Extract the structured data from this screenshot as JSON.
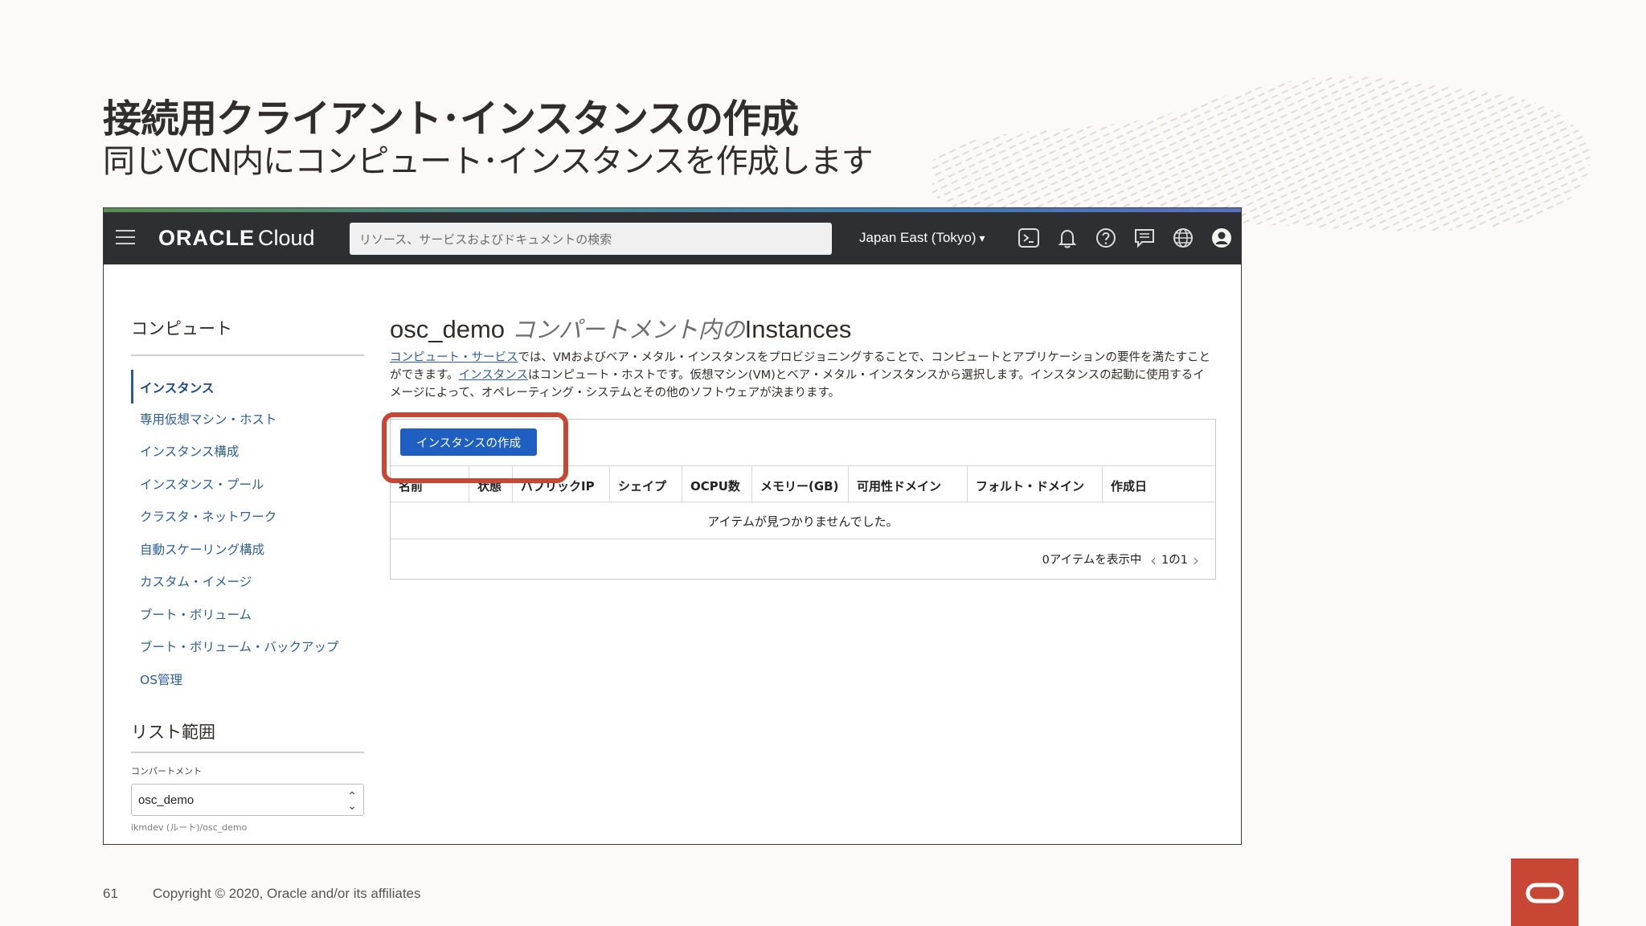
{
  "slide": {
    "title": "接続用クライアント･インスタンスの作成",
    "subtitle": "同じVCN内にコンピュート･インスタンスを作成します",
    "page_number": "61",
    "copyright": "Copyright © 2020, Oracle and/or its affiliates"
  },
  "console": {
    "topbar": {
      "logo_main": "ORACLE",
      "logo_sub": "Cloud",
      "search_placeholder": "リソース、サービスおよびドキュメントの検索",
      "region": "Japan East (Tokyo)",
      "icons": [
        "cloud-shell-icon",
        "bell-icon",
        "help-icon",
        "chat-icon",
        "globe-icon",
        "user-icon"
      ]
    },
    "sidebar": {
      "heading": "コンピュート",
      "items": [
        {
          "label": "インスタンス",
          "active": true
        },
        {
          "label": "専用仮想マシン・ホスト"
        },
        {
          "label": "インスタンス構成"
        },
        {
          "label": "インスタンス・プール"
        },
        {
          "label": "クラスタ・ネットワーク"
        },
        {
          "label": "自動スケーリング構成"
        },
        {
          "label": "カスタム・イメージ"
        },
        {
          "label": "ブート・ボリューム"
        },
        {
          "label": "ブート・ボリューム・バックアップ"
        },
        {
          "label": "OS管理"
        }
      ],
      "scope_heading": "リスト範囲",
      "compartment_label": "コンパートメント",
      "compartment_value": "osc_demo",
      "compartment_path": "ikmdev (ルート)/osc_demo"
    },
    "main": {
      "heading_name": "osc_demo",
      "heading_italic": "コンパートメント内の",
      "heading_suffix": "Instances",
      "desc_link1": "コンピュート・サービス",
      "desc_text1": "では、VMおよびベア・メタル・インスタンスをプロビジョニングすることで、コンピュートとアプリケーションの要件を満たすことができます。",
      "desc_link2": "インスタンス",
      "desc_text2": "はコンピュート・ホストです。仮想マシン(VM)とベア・メタル・インスタンスから選択します。インスタンスの起動に使用するイメージによって、オペレーティング・システムとその他のソフトウェアが決まります。",
      "create_button": "インスタンスの作成",
      "columns": [
        "名前",
        "状態",
        "パブリックIP",
        "シェイプ",
        "OCPU数",
        "メモリー(GB)",
        "可用性ドメイン",
        "フォルト・ドメイン",
        "作成日"
      ],
      "empty_message": "アイテムが見つかりませんでした。",
      "pager_count": "0アイテムを表示中",
      "pager_page": "1の1"
    }
  },
  "colors": {
    "oracle_red": "#c74634",
    "topbar_bg": "#2d2f33",
    "primary_button": "#1f5fc1",
    "link": "#2c5d99"
  }
}
